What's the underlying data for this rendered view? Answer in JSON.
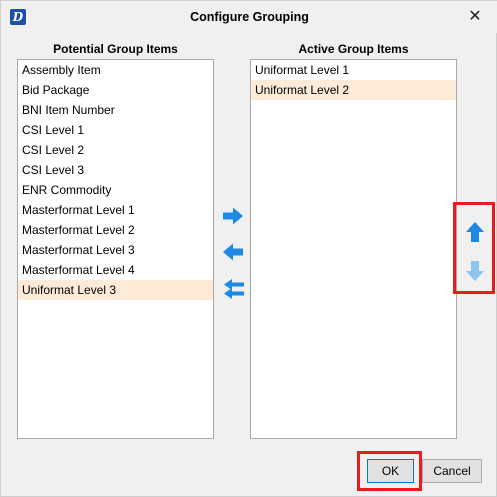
{
  "window": {
    "title": "Configure Grouping",
    "app_icon_letter": "D",
    "close_glyph": "✕"
  },
  "potential": {
    "label": "Potential Group Items",
    "items": [
      {
        "label": "Assembly Item"
      },
      {
        "label": "Bid Package"
      },
      {
        "label": "BNI Item Number"
      },
      {
        "label": "CSI Level 1"
      },
      {
        "label": "CSI Level 2"
      },
      {
        "label": "CSI Level 3"
      },
      {
        "label": "ENR Commodity"
      },
      {
        "label": "Masterformat Level 1"
      },
      {
        "label": "Masterformat Level 2"
      },
      {
        "label": "Masterformat Level 3"
      },
      {
        "label": "Masterformat Level 4"
      },
      {
        "label": "Uniformat Level 3",
        "selected": true
      }
    ]
  },
  "active": {
    "label": "Active Group Items",
    "items": [
      {
        "label": "Uniformat Level 1"
      },
      {
        "label": "Uniformat Level 2",
        "selected": true
      }
    ]
  },
  "icons": {
    "add": "arrow-right-icon",
    "remove": "arrow-left-icon",
    "remove_all": "double-arrow-left-icon",
    "move_up": "arrow-up-icon",
    "move_down": "arrow-down-icon"
  },
  "colors": {
    "arrow_blue": "#1e88e5",
    "arrow_disabled": "#90c4ee",
    "selection": "#fdebd7",
    "highlight_red": "#e81c1c"
  },
  "buttons": {
    "ok": "OK",
    "cancel": "Cancel"
  }
}
